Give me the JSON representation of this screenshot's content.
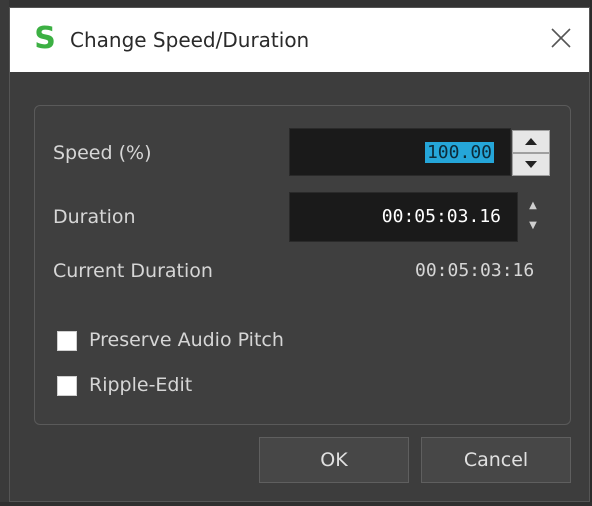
{
  "window": {
    "title": "Change Speed/Duration",
    "logo_letter": "S",
    "logo_color": "#3cb043"
  },
  "speed": {
    "label": "Speed (%)",
    "value": "100.00"
  },
  "duration": {
    "label": "Duration",
    "value": "00:05:03.16"
  },
  "current_duration": {
    "label": "Current Duration",
    "value": "00:05:03:16"
  },
  "options": {
    "preserve_audio_pitch": {
      "label": "Preserve Audio Pitch",
      "checked": false
    },
    "ripple_edit": {
      "label": "Ripple-Edit",
      "checked": false
    }
  },
  "buttons": {
    "ok": "OK",
    "cancel": "Cancel"
  },
  "colors": {
    "selection": "#25a6d9",
    "panel_bg": "#3d3d3d",
    "field_bg": "#1a1a1a"
  }
}
